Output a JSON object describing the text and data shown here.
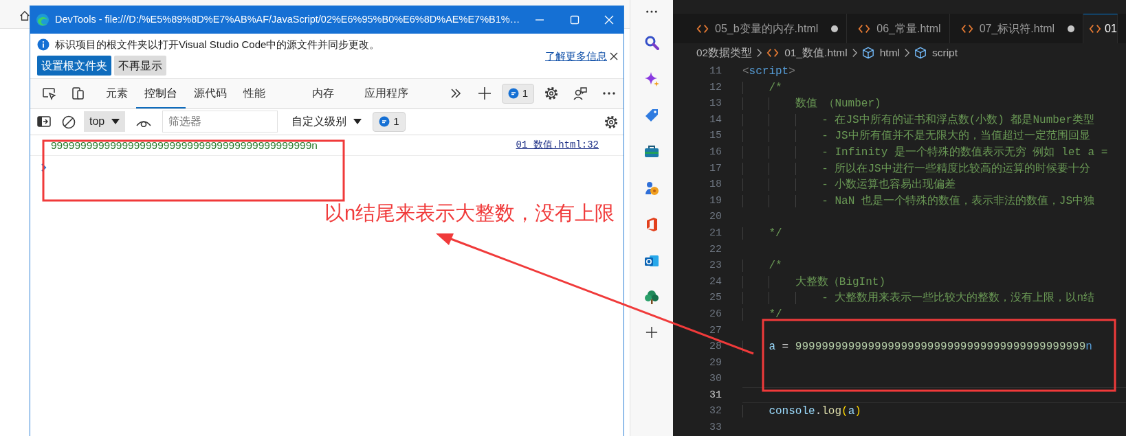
{
  "devtools": {
    "title": "DevTools - file:///D:/%E5%89%8D%E7%AB%AF/JavaScript/02%E6%95%B0%E6%8D%AE%E7%B1%…",
    "infobar": {
      "message": "标识项目的根文件夹以打开Visual Studio Code中的源文件并同步更改。",
      "link": "了解更多信息",
      "buttons": [
        {
          "label": "设置根文件夹",
          "primary": true
        },
        {
          "label": "不再显示",
          "primary": false
        }
      ]
    },
    "tabs": [
      {
        "label": "元素",
        "selected": false
      },
      {
        "label": "控制台",
        "selected": true
      },
      {
        "label": "源代码",
        "selected": false
      },
      {
        "label": "性能",
        "selected": false
      },
      {
        "label": "内存",
        "selected": false
      },
      {
        "label": "应用程序",
        "selected": false
      }
    ],
    "issues": "1",
    "console_toolbar": {
      "context": "top",
      "filter": {
        "placeholder": "筛选器"
      },
      "levels": "自定义级别",
      "issues": "1"
    },
    "messages": [
      {
        "text": "99999999999999999999999999999999999999999999n",
        "source": "01_数值.html:32"
      }
    ]
  },
  "editor": {
    "tabs": [
      {
        "label": "05_b变量的内存.html",
        "modified": true,
        "selected": false
      },
      {
        "label": "06_常量.html",
        "modified": false,
        "selected": false
      },
      {
        "label": "07_标识符.html",
        "modified": true,
        "selected": false
      },
      {
        "label": "01",
        "modified": false,
        "selected": true
      }
    ],
    "breadcrumb": [
      {
        "label": "02数据类型",
        "kind": "folder"
      },
      {
        "label": "01_数值.html",
        "kind": "file"
      },
      {
        "label": "html",
        "kind": "element"
      },
      {
        "label": "script",
        "kind": "element"
      }
    ],
    "lines": [
      {
        "number": "11",
        "current": false,
        "tokens": [
          {
            "text": "<",
            "kind": "punct"
          },
          {
            "text": "script",
            "kind": "tag"
          },
          {
            "text": ">",
            "kind": "punct"
          }
        ]
      },
      {
        "number": "12",
        "current": false,
        "tokens": [
          {
            "text": "    /*",
            "kind": "comment"
          }
        ]
      },
      {
        "number": "13",
        "current": false,
        "tokens": [
          {
            "text": "        数值 （Number)",
            "kind": "comment"
          }
        ]
      },
      {
        "number": "14",
        "current": false,
        "tokens": [
          {
            "text": "            - 在JS中所有的证书和浮点数(小数) 都是Number类型",
            "kind": "comment"
          }
        ]
      },
      {
        "number": "15",
        "current": false,
        "tokens": [
          {
            "text": "            - JS中所有值并不是无限大的，当值超过一定范围回显",
            "kind": "comment"
          }
        ]
      },
      {
        "number": "16",
        "current": false,
        "tokens": [
          {
            "text": "            - Infinity 是一个特殊的数值表示无穷 例如 let a =",
            "kind": "comment"
          }
        ]
      },
      {
        "number": "17",
        "current": false,
        "tokens": [
          {
            "text": "            - 所以在JS中进行一些精度比较高的运算的时候要十分",
            "kind": "comment"
          }
        ]
      },
      {
        "number": "18",
        "current": false,
        "tokens": [
          {
            "text": "            - 小数运算也容易出现偏差",
            "kind": "comment"
          }
        ]
      },
      {
        "number": "19",
        "current": false,
        "tokens": [
          {
            "text": "            - NaN 也是一个特殊的数值，表示非法的数值，JS中独",
            "kind": "comment"
          }
        ]
      },
      {
        "number": "20",
        "current": false
      },
      {
        "number": "21",
        "current": false,
        "tokens": [
          {
            "text": "    */",
            "kind": "comment"
          }
        ]
      },
      {
        "number": "22",
        "current": false
      },
      {
        "number": "23",
        "current": false,
        "tokens": [
          {
            "text": "    /*",
            "kind": "comment"
          }
        ]
      },
      {
        "number": "24",
        "current": false,
        "tokens": [
          {
            "text": "        大整数（BigInt)",
            "kind": "comment"
          }
        ]
      },
      {
        "number": "25",
        "current": false,
        "tokens": [
          {
            "text": "            - 大整数用来表示一些比较大的整数，没有上限，以n结",
            "kind": "comment"
          }
        ]
      },
      {
        "number": "26",
        "current": false,
        "tokens": [
          {
            "text": "    */",
            "kind": "comment"
          }
        ]
      },
      {
        "number": "27",
        "current": false
      },
      {
        "number": "28",
        "current": false,
        "tokens": [
          {
            "text": "    a",
            "kind": "variable"
          },
          {
            "text": " = ",
            "kind": "operator"
          },
          {
            "text": "99999999999999999999999999999999999999999999",
            "kind": "number"
          },
          {
            "text": "n",
            "kind": "keyword"
          }
        ]
      },
      {
        "number": "29",
        "current": false
      },
      {
        "number": "30",
        "current": false
      },
      {
        "number": "31",
        "current": true
      },
      {
        "number": "32",
        "current": false,
        "tokens": [
          {
            "text": "    console",
            "kind": "variable"
          },
          {
            "text": ".",
            "kind": "operator"
          },
          {
            "text": "log",
            "kind": "function"
          },
          {
            "text": "(",
            "kind": "paren"
          },
          {
            "text": "a",
            "kind": "variable"
          },
          {
            "text": ")",
            "kind": "paren"
          }
        ]
      },
      {
        "number": "33",
        "current": false
      }
    ]
  },
  "annotation": {
    "label": "以n结尾来表示大整数，没有上限"
  }
}
